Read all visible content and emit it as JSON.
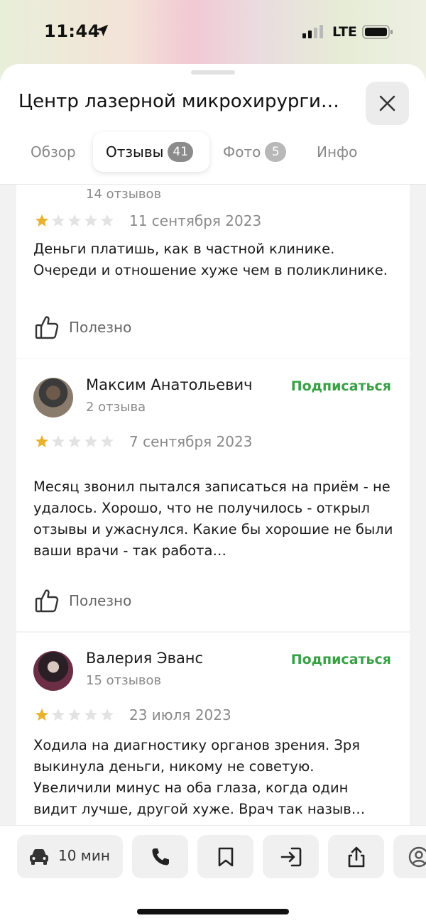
{
  "status_bar": {
    "time": "11:44",
    "network": "LTE"
  },
  "header": {
    "title": "Центр лазерной микрохирурги…",
    "tabs": [
      {
        "label": "Обзор",
        "active": false
      },
      {
        "label": "Отзывы",
        "badge": "41",
        "active": true
      },
      {
        "label": "Фото",
        "badge": "5",
        "active": false
      },
      {
        "label": "Инфо",
        "active": false
      }
    ]
  },
  "reviews": [
    {
      "reviews_count": "14 отзывов",
      "rating": 1,
      "date": "11 сентября 2023",
      "text": "Деньги платишь, как в частной клинике. Очереди и отношение хуже чем в поликлинике.",
      "useful_label": "Полезно"
    },
    {
      "author": "Максим Анатольевич",
      "reviews_count": "2 отзыва",
      "subscribe_label": "Подписаться",
      "rating": 1,
      "date": "7 сентября 2023",
      "text": "Месяц звонил пытался записаться на приём - не удалось. Хорошо, что не получилось - открыл отзывы и ужаснулся. Какие бы хорошие не были ваши врачи - так работа…",
      "useful_label": "Полезно"
    },
    {
      "author": "Валерия Эванс",
      "reviews_count": "15 отзывов",
      "subscribe_label": "Подписаться",
      "rating": 1,
      "date": "23 июля 2023",
      "text": "Ходила на диагностику органов зрения. Зря выкинула деньги, никому не советую. Увеличили минус на оба глаза, когда один видит лучше, другой хуже. Врач так назыв…"
    }
  ],
  "toolbar": {
    "route_time": "10 мин"
  },
  "colors": {
    "accent_green": "#3aa046",
    "star_gold": "#e8b22f",
    "star_empty": "#e3e3e3"
  }
}
